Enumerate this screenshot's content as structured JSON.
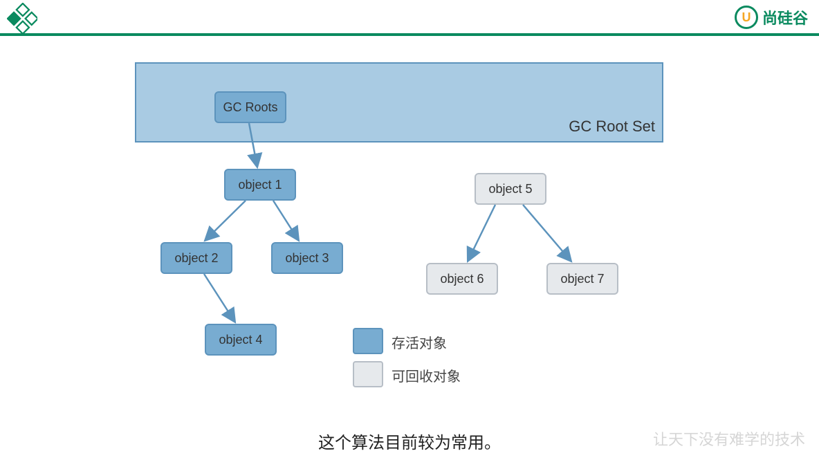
{
  "brand": {
    "name": "尚硅谷"
  },
  "diagram": {
    "rootset_label": "GC Root Set",
    "nodes": {
      "gcroots": {
        "label": "GC Roots",
        "kind": "alive"
      },
      "object1": {
        "label": "object 1",
        "kind": "alive"
      },
      "object2": {
        "label": "object 2",
        "kind": "alive"
      },
      "object3": {
        "label": "object 3",
        "kind": "alive"
      },
      "object4": {
        "label": "object 4",
        "kind": "alive"
      },
      "object5": {
        "label": "object 5",
        "kind": "dead"
      },
      "object6": {
        "label": "object 6",
        "kind": "dead"
      },
      "object7": {
        "label": "object 7",
        "kind": "dead"
      }
    },
    "edges": [
      [
        "gcroots",
        "object1"
      ],
      [
        "object1",
        "object2"
      ],
      [
        "object1",
        "object3"
      ],
      [
        "object2",
        "object4"
      ],
      [
        "object5",
        "object6"
      ],
      [
        "object5",
        "object7"
      ]
    ],
    "legend": {
      "alive": "存活对象",
      "dead": "可回收对象"
    }
  },
  "caption": "这个算法目前较为常用。",
  "watermark": "让天下没有难学的技术"
}
